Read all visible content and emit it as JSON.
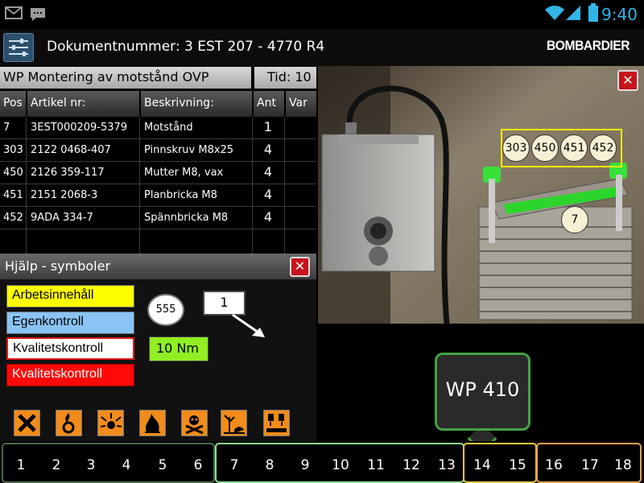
{
  "status_bar": {
    "icons": [
      "gmail-icon",
      "chat-icon",
      "wifi-icon",
      "signal-icon",
      "battery-icon"
    ],
    "time": "9:40"
  },
  "app_bar": {
    "menu_icon": "sliders-icon",
    "document_title": "Dokumentnummer: 3 EST 207 - 4770 R4",
    "brand": "BOMBARDIER"
  },
  "parts_panel": {
    "title": "WP Montering av motstånd OVP",
    "time": "Tid: 10",
    "headers": [
      "Pos",
      "Artikel nr:",
      "Beskrivning:",
      "Ant",
      "Var"
    ],
    "rows": [
      {
        "pos": "7",
        "article": "3EST000209-5379",
        "description": "Motstånd",
        "qty": "1",
        "var": ""
      },
      {
        "pos": "303",
        "article": "2122 0468-407",
        "description": "Pinnskruv M8x25",
        "qty": "4",
        "var": ""
      },
      {
        "pos": "450",
        "article": "2126 359-117",
        "description": "Mutter M8, vax",
        "qty": "4",
        "var": ""
      },
      {
        "pos": "451",
        "article": "2151 2068-3",
        "description": "Planbricka M8",
        "qty": "4",
        "var": ""
      },
      {
        "pos": "452",
        "article": "9ADA 334-7",
        "description": "Spännbricka M8",
        "qty": "4",
        "var": ""
      }
    ]
  },
  "help_panel": {
    "title": "Hjälp - symboler",
    "close_icon": "close-icon",
    "legend": {
      "work": "Arbetsinnehåll",
      "self": "Egenkontroll",
      "quality1": "Kvalitetskontroll",
      "quality2": "Kvalitetskontroll"
    },
    "symbol_position": "555",
    "symbol_count": "1",
    "symbol_torque": "10 Nm",
    "hazards": [
      "harmful-icon",
      "oxidizing-icon",
      "explosive-icon",
      "flammable-icon",
      "toxic-icon",
      "environment-icon",
      "corrosive-icon"
    ]
  },
  "photo": {
    "close_icon": "close-icon",
    "bubbles": [
      "303",
      "450",
      "451",
      "452"
    ],
    "main_bubble": "7"
  },
  "tooltip": {
    "label": "WP 410"
  },
  "step_bar": {
    "group1": [
      "1",
      "2",
      "3",
      "4",
      "5",
      "6"
    ],
    "group2": [
      "7",
      "8",
      "9",
      "10",
      "11",
      "12",
      "13"
    ],
    "group3": [
      "14",
      "15"
    ],
    "group4": [
      "16",
      "17",
      "18"
    ]
  },
  "colors": {
    "accent_blue": "#33b5e5",
    "work_yellow": "#ffff00",
    "self_blue": "#8ac4f4",
    "quality_red": "#ff0808",
    "torque_green": "#90ee22",
    "group2_green": "#8ee28e",
    "group3_yellow": "#e6c83c",
    "group4_orange": "#e6a050"
  }
}
